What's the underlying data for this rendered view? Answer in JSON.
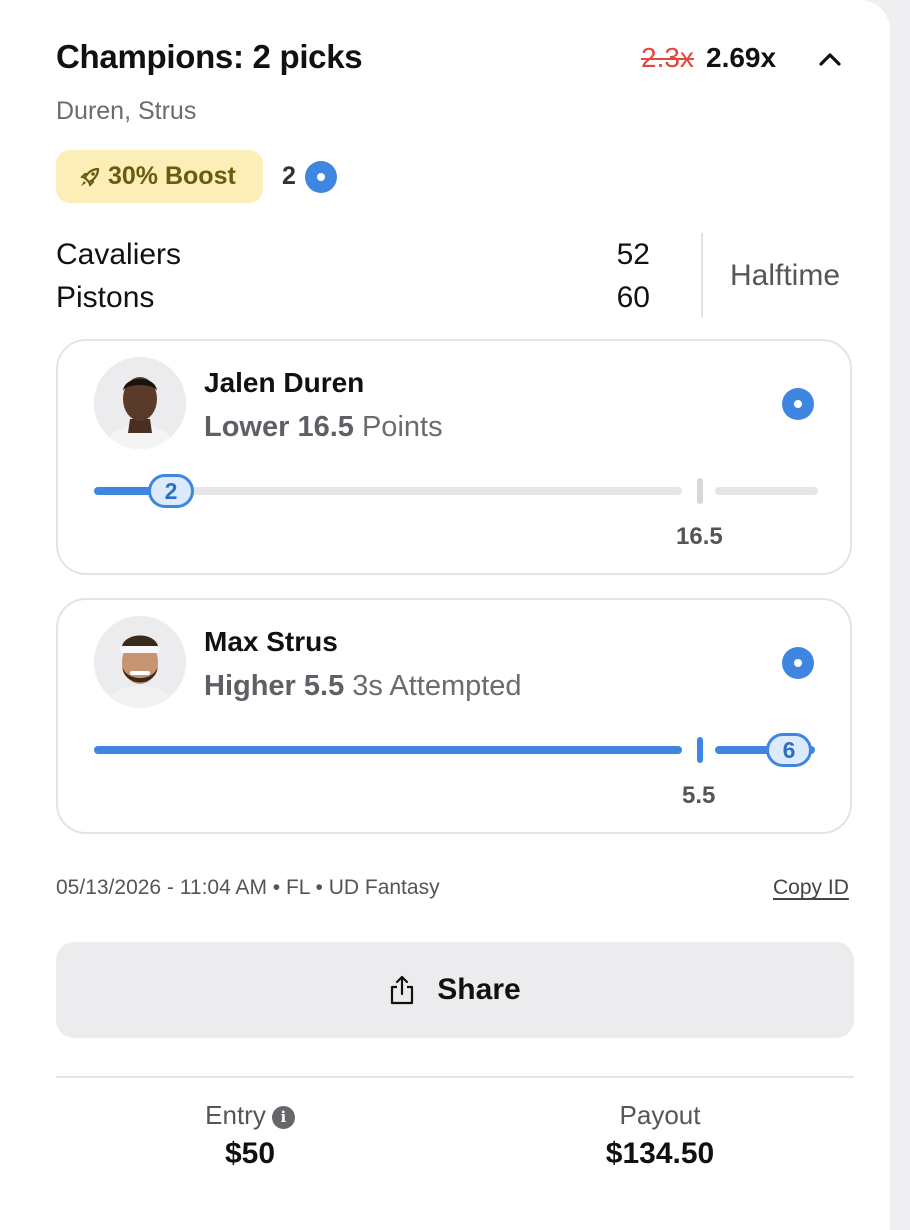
{
  "header": {
    "title": "Champions: 2 picks",
    "multiplier_old": "2.3x",
    "multiplier_new": "2.69x",
    "subtitle": "Duren, Strus"
  },
  "boost": {
    "label": "30% Boost",
    "count": "2"
  },
  "game": {
    "teams": [
      {
        "name": "Cavaliers",
        "score": "52"
      },
      {
        "name": "Pistons",
        "score": "60"
      }
    ],
    "status": "Halftime"
  },
  "picks": [
    {
      "player": "Jalen Duren",
      "direction": "Lower 16.5",
      "stat": "Points",
      "current": "2",
      "line": "16.5",
      "progress_fraction": 0.12
    },
    {
      "player": "Max Strus",
      "direction": "Higher 5.5",
      "stat": "3s Attempted",
      "current": "6",
      "line": "5.5",
      "progress_fraction": 1.0
    }
  ],
  "meta": {
    "timestamp": "05/13/2026 - 11:04 AM • FL • UD Fantasy",
    "copy_id": "Copy ID"
  },
  "share": {
    "label": "Share"
  },
  "footer": {
    "entry_label": "Entry",
    "entry_value": "$50",
    "payout_label": "Payout",
    "payout_value": "$134.50"
  },
  "colors": {
    "accent": "#3f86e0",
    "boost_bg": "#fbefb7",
    "strike_red": "#e0483e"
  },
  "icons": [
    "chevron-up-icon",
    "rocket-icon",
    "selected-dot-icon",
    "share-icon",
    "info-icon"
  ]
}
